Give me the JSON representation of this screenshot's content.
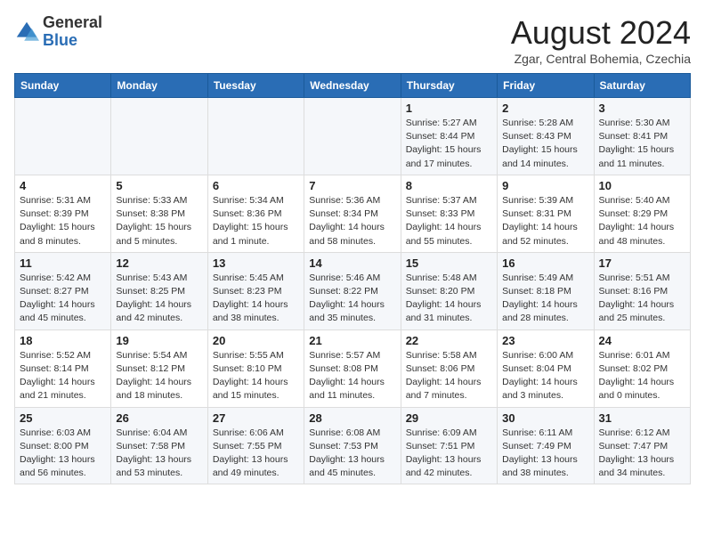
{
  "header": {
    "logo_general": "General",
    "logo_blue": "Blue",
    "month_title": "August 2024",
    "subtitle": "Zgar, Central Bohemia, Czechia"
  },
  "weekdays": [
    "Sunday",
    "Monday",
    "Tuesday",
    "Wednesday",
    "Thursday",
    "Friday",
    "Saturday"
  ],
  "weeks": [
    [
      {
        "day": "",
        "info": ""
      },
      {
        "day": "",
        "info": ""
      },
      {
        "day": "",
        "info": ""
      },
      {
        "day": "",
        "info": ""
      },
      {
        "day": "1",
        "info": "Sunrise: 5:27 AM\nSunset: 8:44 PM\nDaylight: 15 hours\nand 17 minutes."
      },
      {
        "day": "2",
        "info": "Sunrise: 5:28 AM\nSunset: 8:43 PM\nDaylight: 15 hours\nand 14 minutes."
      },
      {
        "day": "3",
        "info": "Sunrise: 5:30 AM\nSunset: 8:41 PM\nDaylight: 15 hours\nand 11 minutes."
      }
    ],
    [
      {
        "day": "4",
        "info": "Sunrise: 5:31 AM\nSunset: 8:39 PM\nDaylight: 15 hours\nand 8 minutes."
      },
      {
        "day": "5",
        "info": "Sunrise: 5:33 AM\nSunset: 8:38 PM\nDaylight: 15 hours\nand 5 minutes."
      },
      {
        "day": "6",
        "info": "Sunrise: 5:34 AM\nSunset: 8:36 PM\nDaylight: 15 hours\nand 1 minute."
      },
      {
        "day": "7",
        "info": "Sunrise: 5:36 AM\nSunset: 8:34 PM\nDaylight: 14 hours\nand 58 minutes."
      },
      {
        "day": "8",
        "info": "Sunrise: 5:37 AM\nSunset: 8:33 PM\nDaylight: 14 hours\nand 55 minutes."
      },
      {
        "day": "9",
        "info": "Sunrise: 5:39 AM\nSunset: 8:31 PM\nDaylight: 14 hours\nand 52 minutes."
      },
      {
        "day": "10",
        "info": "Sunrise: 5:40 AM\nSunset: 8:29 PM\nDaylight: 14 hours\nand 48 minutes."
      }
    ],
    [
      {
        "day": "11",
        "info": "Sunrise: 5:42 AM\nSunset: 8:27 PM\nDaylight: 14 hours\nand 45 minutes."
      },
      {
        "day": "12",
        "info": "Sunrise: 5:43 AM\nSunset: 8:25 PM\nDaylight: 14 hours\nand 42 minutes."
      },
      {
        "day": "13",
        "info": "Sunrise: 5:45 AM\nSunset: 8:23 PM\nDaylight: 14 hours\nand 38 minutes."
      },
      {
        "day": "14",
        "info": "Sunrise: 5:46 AM\nSunset: 8:22 PM\nDaylight: 14 hours\nand 35 minutes."
      },
      {
        "day": "15",
        "info": "Sunrise: 5:48 AM\nSunset: 8:20 PM\nDaylight: 14 hours\nand 31 minutes."
      },
      {
        "day": "16",
        "info": "Sunrise: 5:49 AM\nSunset: 8:18 PM\nDaylight: 14 hours\nand 28 minutes."
      },
      {
        "day": "17",
        "info": "Sunrise: 5:51 AM\nSunset: 8:16 PM\nDaylight: 14 hours\nand 25 minutes."
      }
    ],
    [
      {
        "day": "18",
        "info": "Sunrise: 5:52 AM\nSunset: 8:14 PM\nDaylight: 14 hours\nand 21 minutes."
      },
      {
        "day": "19",
        "info": "Sunrise: 5:54 AM\nSunset: 8:12 PM\nDaylight: 14 hours\nand 18 minutes."
      },
      {
        "day": "20",
        "info": "Sunrise: 5:55 AM\nSunset: 8:10 PM\nDaylight: 14 hours\nand 15 minutes."
      },
      {
        "day": "21",
        "info": "Sunrise: 5:57 AM\nSunset: 8:08 PM\nDaylight: 14 hours\nand 11 minutes."
      },
      {
        "day": "22",
        "info": "Sunrise: 5:58 AM\nSunset: 8:06 PM\nDaylight: 14 hours\nand 7 minutes."
      },
      {
        "day": "23",
        "info": "Sunrise: 6:00 AM\nSunset: 8:04 PM\nDaylight: 14 hours\nand 3 minutes."
      },
      {
        "day": "24",
        "info": "Sunrise: 6:01 AM\nSunset: 8:02 PM\nDaylight: 14 hours\nand 0 minutes."
      }
    ],
    [
      {
        "day": "25",
        "info": "Sunrise: 6:03 AM\nSunset: 8:00 PM\nDaylight: 13 hours\nand 56 minutes."
      },
      {
        "day": "26",
        "info": "Sunrise: 6:04 AM\nSunset: 7:58 PM\nDaylight: 13 hours\nand 53 minutes."
      },
      {
        "day": "27",
        "info": "Sunrise: 6:06 AM\nSunset: 7:55 PM\nDaylight: 13 hours\nand 49 minutes."
      },
      {
        "day": "28",
        "info": "Sunrise: 6:08 AM\nSunset: 7:53 PM\nDaylight: 13 hours\nand 45 minutes."
      },
      {
        "day": "29",
        "info": "Sunrise: 6:09 AM\nSunset: 7:51 PM\nDaylight: 13 hours\nand 42 minutes."
      },
      {
        "day": "30",
        "info": "Sunrise: 6:11 AM\nSunset: 7:49 PM\nDaylight: 13 hours\nand 38 minutes."
      },
      {
        "day": "31",
        "info": "Sunrise: 6:12 AM\nSunset: 7:47 PM\nDaylight: 13 hours\nand 34 minutes."
      }
    ]
  ]
}
